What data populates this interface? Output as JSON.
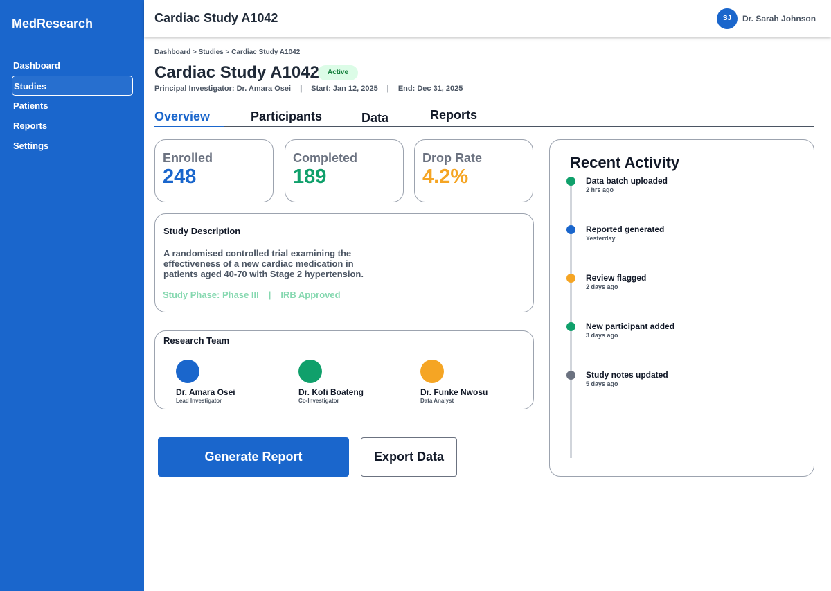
{
  "app": {
    "brand": "MedResearch"
  },
  "sidebar": {
    "items": [
      {
        "label": "Dashboard",
        "active": false
      },
      {
        "label": "Studies",
        "active": true
      },
      {
        "label": "Patients",
        "active": false
      },
      {
        "label": "Reports",
        "active": false
      },
      {
        "label": "Settings",
        "active": false
      }
    ]
  },
  "header": {
    "title": "Cardiac Study A1042",
    "user_initials": "SJ",
    "user_name": "Dr. Sarah Johnson"
  },
  "breadcrumb": "Dashboard > Studies > Cardiac Study A1042",
  "study": {
    "title": "Cardiac Study A1042",
    "status": "Active",
    "investigator": "Principal Investigator: Dr. Amara Osei",
    "start": "Start: Jan 12, 2025",
    "end": "End: Dec 31, 2025",
    "separator": "|"
  },
  "tabs": [
    {
      "label": "Overview",
      "active": true
    },
    {
      "label": "Participants",
      "active": false
    },
    {
      "label": "Data",
      "active": false
    },
    {
      "label": "Reports",
      "active": false
    }
  ],
  "stats": [
    {
      "label": "Enrolled",
      "value": "248",
      "color": "#1a66cc"
    },
    {
      "label": "Completed",
      "value": "189",
      "color": "#10a06b"
    },
    {
      "label": "Drop Rate",
      "value": "4.2%",
      "color": "#f5a524"
    }
  ],
  "description": {
    "title": "Study Description",
    "text": "A randomised controlled trial examining the effectiveness of a new cardiac medication in patients aged 40-70 with Stage 2 hypertension.",
    "phase": "Study Phase: Phase III",
    "separator": "|",
    "irb": "IRB Approved"
  },
  "team": {
    "title": "Research Team",
    "members": [
      {
        "name": "Dr. Amara Osei",
        "role": "Lead Investigator",
        "color": "#1a66cc"
      },
      {
        "name": "Dr. Kofi Boateng",
        "role": "Co-Investigator",
        "color": "#10a06b"
      },
      {
        "name": "Dr. Funke Nwosu",
        "role": "Data Analyst",
        "color": "#f5a524"
      }
    ]
  },
  "actions": {
    "generate_report": "Generate Report",
    "export_data": "Export Data"
  },
  "activity": {
    "title": "Recent Activity",
    "items": [
      {
        "text": "Data batch uploaded",
        "time": "2 hrs ago",
        "color": "#10a06b"
      },
      {
        "text": "Reported generated",
        "time": "Yesterday",
        "color": "#1a66cc"
      },
      {
        "text": "Review flagged",
        "time": "2 days ago",
        "color": "#f5a524"
      },
      {
        "text": "New participant added",
        "time": "3 days ago",
        "color": "#10a06b"
      },
      {
        "text": "Study notes updated",
        "time": "5 days ago",
        "color": "#6b7280"
      }
    ]
  }
}
